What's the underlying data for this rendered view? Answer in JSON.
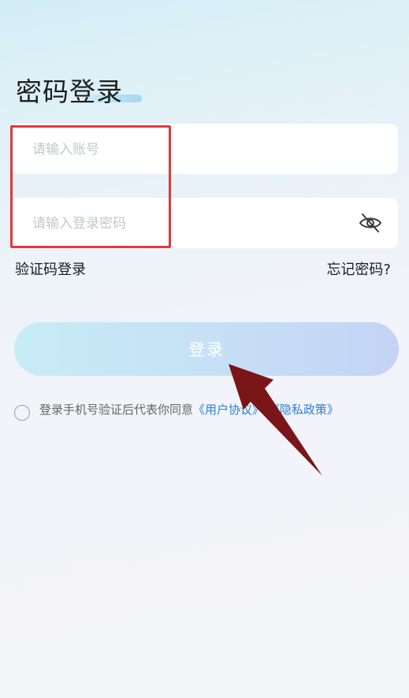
{
  "header": {
    "title": "密码登录"
  },
  "form": {
    "account_placeholder": "请输入账号",
    "password_placeholder": "请输入登录密码",
    "password_toggle_icon": "eye-off-icon"
  },
  "links": {
    "sms_login": "验证码登录",
    "forgot_password": "忘记密码?"
  },
  "login_button": {
    "label": "登录"
  },
  "agreement": {
    "text": "登录手机号验证后代表你同意",
    "user_agreement": "《用户协议》",
    "privacy_policy": "《隐私政策》",
    "checked": false
  },
  "annotations": {
    "highlight_color": "#e03a3a",
    "arrow_color": "#7a1518"
  },
  "colors": {
    "link": "#2d7fd4",
    "button_start": "#c7ecf6",
    "button_end": "#c3d3f5"
  }
}
